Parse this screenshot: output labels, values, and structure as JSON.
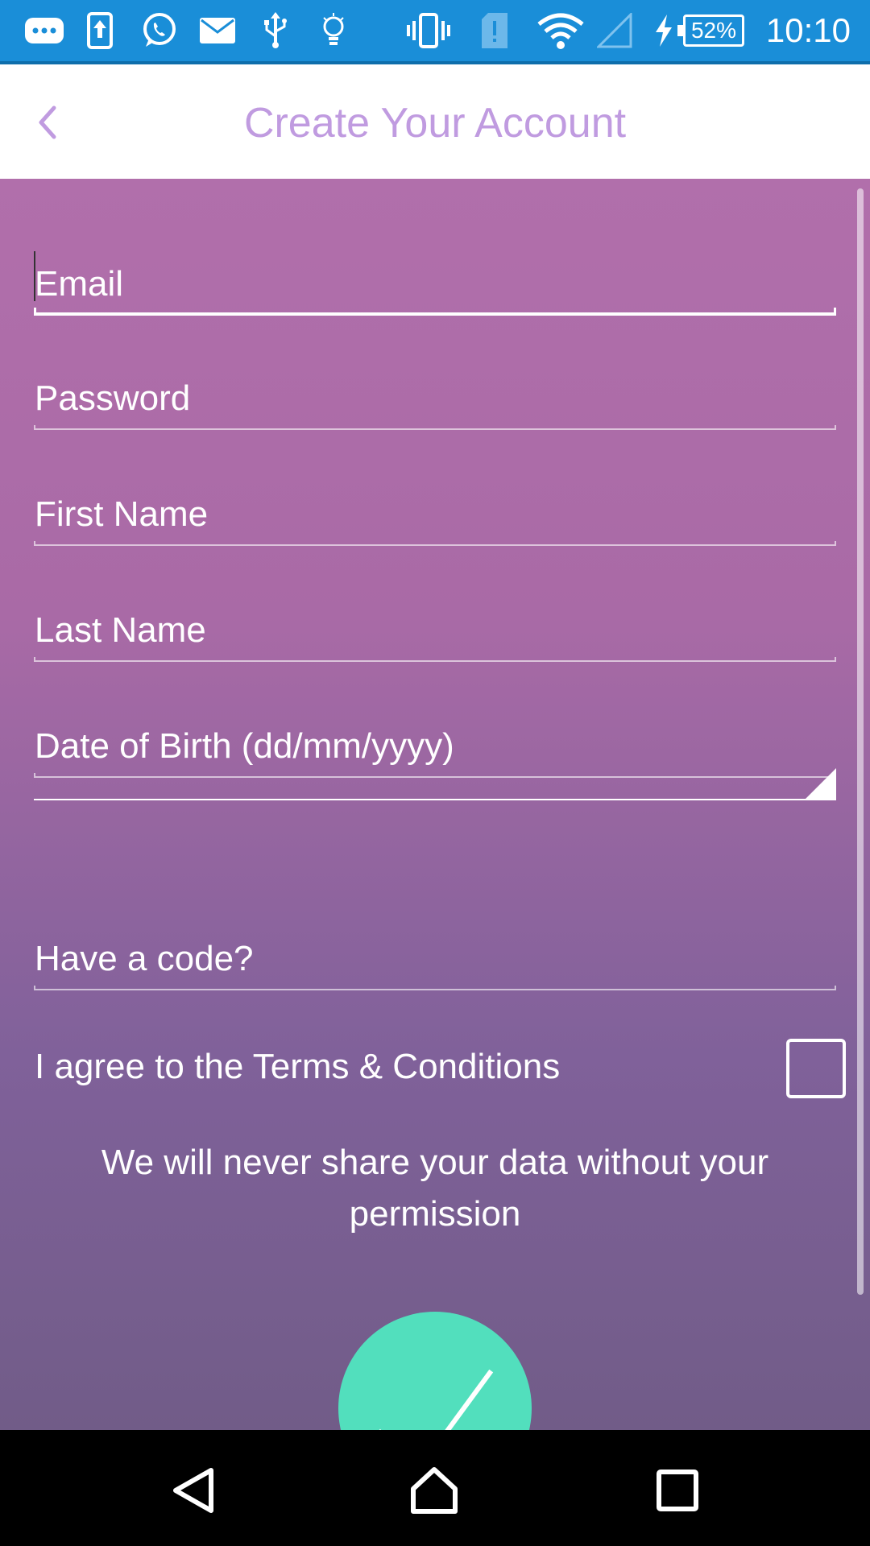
{
  "status_bar": {
    "icons": [
      "chat-bubble-icon",
      "upload-icon",
      "whatsapp-icon",
      "mail-icon",
      "usb-icon",
      "lightbulb-icon",
      "vibrate-icon",
      "sim-alert-icon",
      "wifi-icon",
      "cell-signal-icon",
      "charging-icon"
    ],
    "battery": "52%",
    "time": "10:10"
  },
  "header": {
    "title": "Create Your Account",
    "back_icon": "chevron-left-icon"
  },
  "form": {
    "email_placeholder": "Email",
    "password_placeholder": "Password",
    "first_name_placeholder": "First Name",
    "last_name_placeholder": "Last Name",
    "dob_placeholder": "Date of Birth (dd/mm/yyyy)",
    "dropdown_value": "",
    "code_placeholder": "Have a code?",
    "terms_label": "I agree to the Terms & Conditions",
    "terms_checked": false,
    "privacy_note": "We will never share your data without your permission"
  },
  "submit": {
    "icon": "checkmark-icon"
  },
  "nav_bar": {
    "buttons": [
      "back-triangle-icon",
      "home-icon",
      "recents-icon"
    ]
  },
  "colors": {
    "status_bar": "#1a8ed8",
    "title": "#c09be0",
    "gradient_top": "#b16fab",
    "gradient_bottom": "#715c88",
    "submit": "#52dfbd"
  }
}
